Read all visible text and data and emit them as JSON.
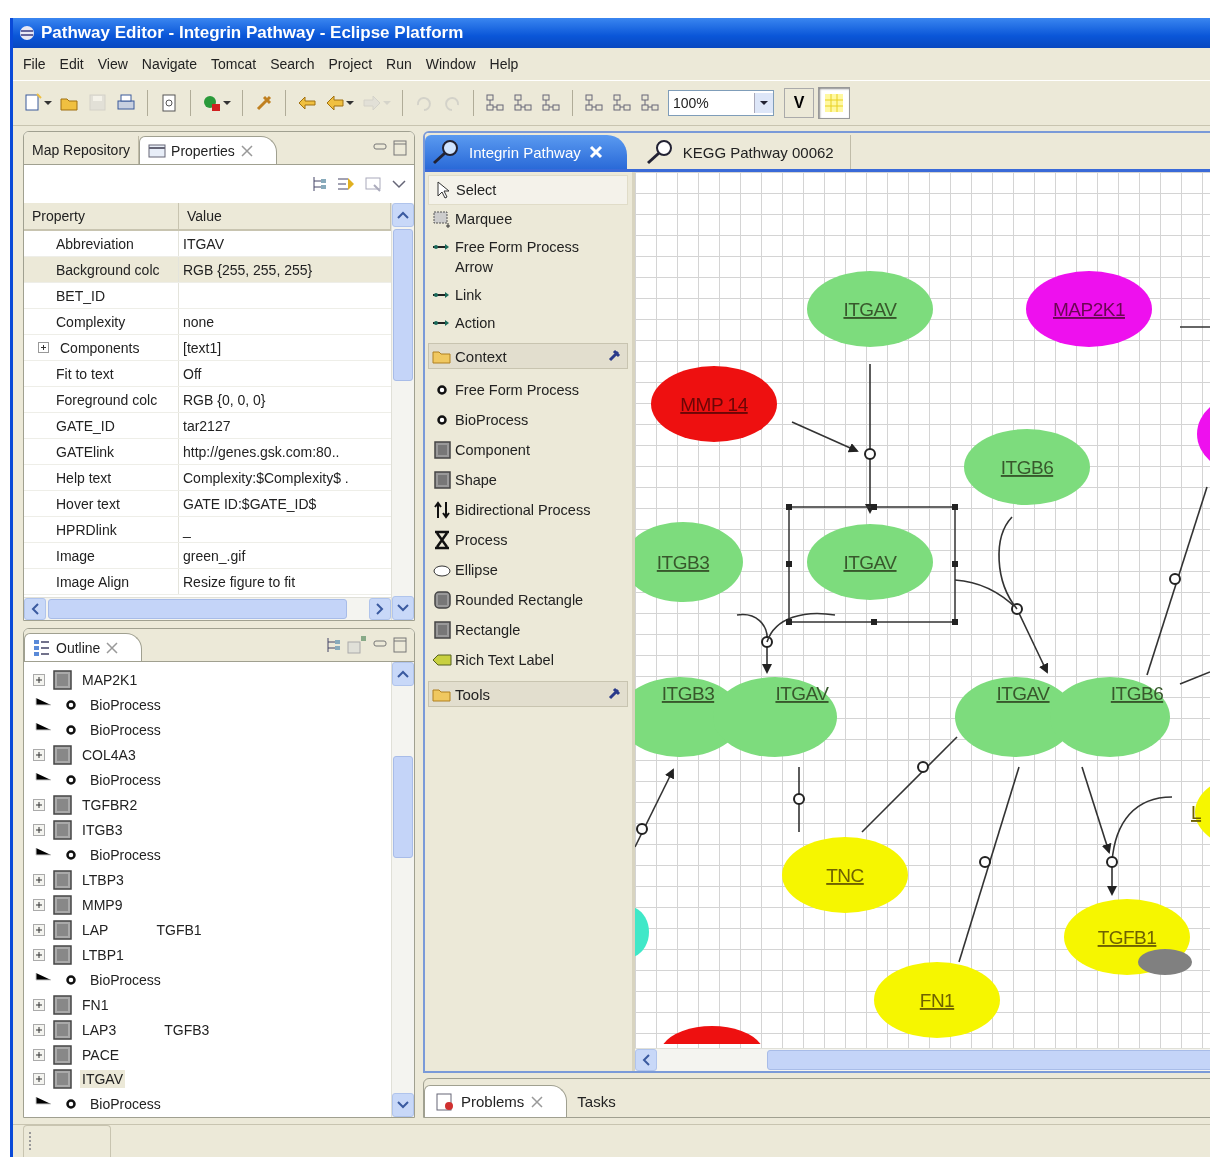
{
  "window": {
    "title": "Pathway Editor - Integrin Pathway - Eclipse Platform"
  },
  "menu": [
    "File",
    "Edit",
    "View",
    "Navigate",
    "Tomcat",
    "Search",
    "Project",
    "Run",
    "Window",
    "Help"
  ],
  "toolbar": {
    "buttons": [
      {
        "kind": "new",
        "disabled": false,
        "menu": true
      },
      {
        "kind": "open",
        "disabled": false,
        "menu": false
      },
      {
        "kind": "save",
        "disabled": true,
        "menu": false
      },
      {
        "kind": "print",
        "disabled": false,
        "menu": false
      },
      {
        "kind": "separator"
      },
      {
        "kind": "page",
        "disabled": false,
        "menu": false
      },
      {
        "kind": "separator"
      },
      {
        "kind": "run",
        "disabled": false,
        "menu": true
      },
      {
        "kind": "separator"
      },
      {
        "kind": "pin",
        "disabled": false,
        "menu": false
      },
      {
        "kind": "separator"
      },
      {
        "kind": "nav-back",
        "disabled": false,
        "menu": false
      },
      {
        "kind": "back",
        "disabled": false,
        "menu": true
      },
      {
        "kind": "forward",
        "disabled": true,
        "menu": true
      },
      {
        "kind": "separator"
      },
      {
        "kind": "undo",
        "disabled": true,
        "menu": false
      },
      {
        "kind": "redo",
        "disabled": true,
        "menu": false
      },
      {
        "kind": "separator"
      },
      {
        "kind": "layout",
        "disabled": false,
        "menu": false
      },
      {
        "kind": "layout",
        "disabled": false,
        "menu": false
      },
      {
        "kind": "layout",
        "disabled": false,
        "menu": false
      },
      {
        "kind": "separator"
      },
      {
        "kind": "layout",
        "disabled": false,
        "menu": false
      },
      {
        "kind": "layout",
        "disabled": false,
        "menu": false
      },
      {
        "kind": "layout",
        "disabled": false,
        "menu": false
      }
    ],
    "zoom": "100%",
    "v_button": "V",
    "grid": {
      "pressed": true
    }
  },
  "properties_panel": {
    "tabs": [
      {
        "label": "Map Repository",
        "kind": "plain",
        "selected": false
      },
      {
        "label": "Properties",
        "kind": "properties",
        "selected": true
      }
    ],
    "columns": [
      "Property",
      "Value"
    ],
    "rows": [
      {
        "property": "Abbreviation",
        "value": "ITGAV",
        "kind": "plain",
        "selected": false
      },
      {
        "property": "Background colc",
        "value": "RGB {255, 255, 255}",
        "kind": "plain",
        "selected": true
      },
      {
        "property": "BET_ID",
        "kind": "plain",
        "selected": false
      },
      {
        "property": "Complexity",
        "value": "none",
        "kind": "plain",
        "selected": false
      },
      {
        "property": "Components",
        "value": "[text1]",
        "kind": "category",
        "selected": false
      },
      {
        "property": "Fit to text",
        "value": "Off",
        "kind": "plain",
        "selected": false
      },
      {
        "property": "Foreground colc",
        "value": "RGB {0, 0, 0}",
        "kind": "plain",
        "selected": false
      },
      {
        "property": "GATE_ID",
        "value": "tar2127",
        "kind": "plain",
        "selected": false
      },
      {
        "property": "GATElink",
        "value": "http://genes.gsk.com:80..",
        "kind": "plain",
        "selected": false
      },
      {
        "property": "Help text",
        "value": "Complexity:$Complexity$ .",
        "kind": "plain",
        "selected": false
      },
      {
        "property": "Hover text",
        "value": "GATE ID:$GATE_ID$",
        "kind": "plain",
        "selected": false
      },
      {
        "property": "HPRDlink",
        "value": "_",
        "kind": "plain",
        "selected": false
      },
      {
        "property": "Image",
        "value": "green_.gif",
        "kind": "plain",
        "selected": false
      },
      {
        "property": "Image Align",
        "value": "Resize figure to fit",
        "kind": "plain",
        "selected": false
      }
    ]
  },
  "outline_panel": {
    "title": "Outline",
    "items": [
      {
        "kind": "component",
        "label": "MAP2K1",
        "selected": false
      },
      {
        "kind": "bioprocess",
        "label": "BioProcess",
        "selected": false
      },
      {
        "kind": "bioprocess",
        "label": "BioProcess",
        "selected": false
      },
      {
        "kind": "component",
        "label": "COL4A3",
        "selected": false
      },
      {
        "kind": "bioprocess",
        "label": "BioProcess",
        "selected": false
      },
      {
        "kind": "component",
        "label": "TGFBR2",
        "selected": false
      },
      {
        "kind": "component",
        "label": "ITGB3",
        "selected": false
      },
      {
        "kind": "bioprocess",
        "label": "BioProcess",
        "selected": false
      },
      {
        "kind": "component",
        "label": "LTBP3",
        "selected": false
      },
      {
        "kind": "component",
        "label": "MMP9",
        "selected": false
      },
      {
        "kind": "component",
        "label": "LAP",
        "note": "TGFB1",
        "selected": false
      },
      {
        "kind": "component",
        "label": "LTBP1",
        "selected": false
      },
      {
        "kind": "bioprocess",
        "label": "BioProcess",
        "selected": false
      },
      {
        "kind": "component",
        "label": "FN1",
        "selected": false
      },
      {
        "kind": "component",
        "label": "LAP3",
        "note": "TGFB3",
        "selected": false
      },
      {
        "kind": "component",
        "label": "PACE",
        "selected": false
      },
      {
        "kind": "component",
        "label": "ITGAV",
        "selected": true
      },
      {
        "kind": "bioprocess",
        "label": "BioProcess",
        "selected": false
      }
    ]
  },
  "editor": {
    "tabs": [
      {
        "label": "Integrin Pathway",
        "selected": true
      },
      {
        "label": "KEGG Pathway 00062",
        "selected": false
      }
    ],
    "palette": [
      {
        "kind": "select",
        "label": "Select",
        "selected": true
      },
      {
        "kind": "marquee",
        "label": "Marquee",
        "selected": false
      },
      {
        "kind": "connection",
        "label": "Free Form Process Arrow",
        "selected": false
      },
      {
        "kind": "connection",
        "label": "Link",
        "selected": false
      },
      {
        "kind": "connection",
        "label": "Action",
        "selected": false
      },
      {
        "kind": "drawer",
        "label": "Context"
      },
      {
        "kind": "bullet",
        "label": "Free Form Process",
        "selected": false
      },
      {
        "kind": "bullet",
        "label": "BioProcess",
        "selected": false
      },
      {
        "kind": "square",
        "label": "Component",
        "selected": false
      },
      {
        "kind": "square",
        "label": "Shape",
        "selected": false
      },
      {
        "kind": "bidirectional",
        "label": "Bidirectional Process",
        "selected": false
      },
      {
        "kind": "process",
        "label": "Process",
        "selected": false
      },
      {
        "kind": "ellipse",
        "label": "Ellipse",
        "selected": false
      },
      {
        "kind": "rounded",
        "label": "Rounded Rectangle",
        "selected": false
      },
      {
        "kind": "square",
        "label": "Rectangle",
        "selected": false
      },
      {
        "kind": "label",
        "label": "Rich Text Label",
        "selected": false
      },
      {
        "kind": "drawer",
        "label": "Tools"
      }
    ],
    "diagram": {
      "nodes": [
        {
          "kind": "protein",
          "label": "ITGAV",
          "color": "#7ddc7d",
          "selected": false
        },
        {
          "kind": "protein",
          "label": "MAP2K1",
          "color": "#ee10ee",
          "selected": false
        },
        {
          "kind": "protein",
          "label": "MMP 14",
          "color": "#ee1010",
          "selected": false
        },
        {
          "kind": "protein",
          "color": "#ee10ee",
          "selected": false
        },
        {
          "kind": "protein",
          "label": "ITGB6",
          "color": "#7ddc7d",
          "selected": false
        },
        {
          "kind": "protein",
          "label": "ITGB3",
          "color": "#7ddc7d",
          "selected": false
        },
        {
          "kind": "protein",
          "label": "ITGAV",
          "color": "#7ddc7d",
          "selected": true
        },
        {
          "kind": "complex",
          "labels": [
            "ITGB3",
            "ITGAV"
          ],
          "color": "#7ddc7d",
          "selected": false
        },
        {
          "kind": "complex",
          "labels": [
            "ITGAV",
            "ITGB6"
          ],
          "color": "#7ddc7d",
          "selected": false
        },
        {
          "kind": "protein",
          "label": "L",
          "color": "#f6f600",
          "selected": false
        },
        {
          "kind": "protein",
          "label": "TNC",
          "color": "#f6f600",
          "selected": false
        },
        {
          "kind": "protein",
          "color": "#40e8c8",
          "selected": false
        },
        {
          "kind": "protein",
          "label": "TGFB1",
          "color": "#f6f600",
          "selected": false
        },
        {
          "kind": "protein",
          "label": "FN1",
          "color": "#f6f600",
          "selected": false
        },
        {
          "kind": "protein",
          "color": "#ee1010",
          "selected": false
        }
      ]
    }
  },
  "bottom_panel": {
    "tabs": [
      {
        "label": "Problems",
        "selected": true
      },
      {
        "label": "Tasks",
        "selected": false
      }
    ]
  }
}
